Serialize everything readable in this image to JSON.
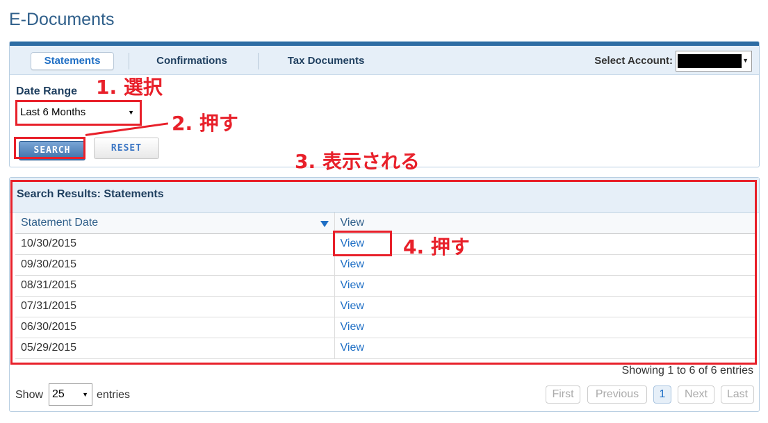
{
  "page": {
    "title": "E-Documents"
  },
  "tabs": [
    {
      "label": "Statements",
      "active": true
    },
    {
      "label": "Confirmations",
      "active": false
    },
    {
      "label": "Tax Documents",
      "active": false
    }
  ],
  "account": {
    "label": "Select Account:",
    "value": ""
  },
  "filter": {
    "date_range_label": "Date Range",
    "date_range_value": "Last 6 Months",
    "search_label": "SEARCH",
    "reset_label": "RESET"
  },
  "results": {
    "title": "Search Results: Statements",
    "columns": [
      "Statement Date",
      "View"
    ],
    "rows": [
      {
        "date": "10/30/2015",
        "link": "View"
      },
      {
        "date": "09/30/2015",
        "link": "View"
      },
      {
        "date": "08/31/2015",
        "link": "View"
      },
      {
        "date": "07/31/2015",
        "link": "View"
      },
      {
        "date": "06/30/2015",
        "link": "View"
      },
      {
        "date": "05/29/2015",
        "link": "View"
      }
    ],
    "showing": "Showing 1 to 6 of 6 entries",
    "show_label": "Show",
    "page_size": "25",
    "entries_label": "entries"
  },
  "pagination": {
    "first": "First",
    "previous": "Previous",
    "current": "1",
    "next": "Next",
    "last": "Last"
  },
  "annotations": {
    "step1": "1. 選択",
    "step2": "2. 押す",
    "step3": "3. 表示される",
    "step4": "4. 押す"
  },
  "colors": {
    "accent": "#1f6fc5",
    "header_bg": "#e6eff8",
    "annotation": "#e8202a",
    "title": "#2f5f8a"
  }
}
